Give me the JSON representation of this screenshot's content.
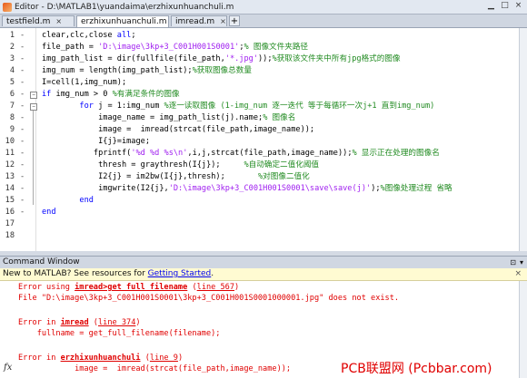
{
  "window": {
    "title": "Editor - D:\\MATLAB1\\yuandaima\\erzhixunhuanchuli.m"
  },
  "tabs": [
    {
      "label": "testfield.m",
      "close": "×",
      "active": false
    },
    {
      "label": "erzhixunhuanchuli.m",
      "close": "×",
      "active": true
    },
    {
      "label": "imread.m",
      "close": "×",
      "active": false
    }
  ],
  "tab_add": "+",
  "code_lines": [
    {
      "n": "1",
      "dash": "-",
      "segs": [
        {
          "t": "clear,clc,close ",
          "c": ""
        },
        {
          "t": "all",
          "c": "kw"
        },
        {
          "t": ";",
          "c": ""
        }
      ]
    },
    {
      "n": "2",
      "dash": "-",
      "segs": [
        {
          "t": "file_path = ",
          "c": ""
        },
        {
          "t": "'D:\\image\\3kp+3_C001H001S0001'",
          "c": "str"
        },
        {
          "t": ";",
          "c": ""
        },
        {
          "t": "% 图像文件夹路径",
          "c": "cm"
        }
      ]
    },
    {
      "n": "3",
      "dash": "-",
      "segs": [
        {
          "t": "img_path_list = dir(fullfile(file_path,",
          "c": ""
        },
        {
          "t": "'*.jpg'",
          "c": "str"
        },
        {
          "t": "));",
          "c": ""
        },
        {
          "t": "%获取该文件夹中所有jpg格式的图像",
          "c": "cm"
        }
      ]
    },
    {
      "n": "4",
      "dash": "-",
      "segs": [
        {
          "t": "img_num = length(img_path_list);",
          "c": ""
        },
        {
          "t": "%获取图像总数量",
          "c": "cm"
        }
      ]
    },
    {
      "n": "5",
      "dash": "-",
      "segs": [
        {
          "t": "I=cell(1,img_num);",
          "c": ""
        }
      ]
    },
    {
      "n": "6",
      "dash": "-",
      "segs": [
        {
          "t": "if",
          "c": "kw"
        },
        {
          "t": " img_num > 0 ",
          "c": ""
        },
        {
          "t": "%有满足条件的图像",
          "c": "cm"
        }
      ]
    },
    {
      "n": "7",
      "dash": "-",
      "segs": [
        {
          "t": "        ",
          "c": ""
        },
        {
          "t": "for",
          "c": "kw"
        },
        {
          "t": " j = 1:img_num ",
          "c": ""
        },
        {
          "t": "%逐一读取图像 (1-img_num 逐一迭代 等于每循环一次j+1 直到img_num)",
          "c": "cm"
        }
      ]
    },
    {
      "n": "8",
      "dash": "-",
      "segs": [
        {
          "t": "            image_name = img_path_list(j).name;",
          "c": ""
        },
        {
          "t": "% 图像名",
          "c": "cm"
        }
      ]
    },
    {
      "n": "9",
      "dash": "-",
      "segs": [
        {
          "t": "            image =  imread(strcat(file_path,image_name));",
          "c": ""
        }
      ]
    },
    {
      "n": "10",
      "dash": "-",
      "segs": [
        {
          "t": "            I{j}=image;",
          "c": ""
        }
      ]
    },
    {
      "n": "11",
      "dash": "-",
      "segs": [
        {
          "t": "           fprintf(",
          "c": ""
        },
        {
          "t": "'%d %d %s\\n'",
          "c": "str"
        },
        {
          "t": ",i,j,strcat(file_path,image_name));",
          "c": ""
        },
        {
          "t": "% 显示正在处理的图像名",
          "c": "cm"
        }
      ]
    },
    {
      "n": "12",
      "dash": "-",
      "segs": [
        {
          "t": "            thresh = graythresh(I{j});     ",
          "c": ""
        },
        {
          "t": "%自动确定二值化阈值",
          "c": "cm"
        }
      ]
    },
    {
      "n": "13",
      "dash": "-",
      "segs": [
        {
          "t": "            I2{j} = im2bw(I{j},thresh);       ",
          "c": ""
        },
        {
          "t": "%对图像二值化",
          "c": "cm"
        }
      ]
    },
    {
      "n": "14",
      "dash": "-",
      "segs": [
        {
          "t": "            imgwrite(I2{j},",
          "c": ""
        },
        {
          "t": "'D:\\image\\3kp+3_C001H001S0001\\save\\save(j)'",
          "c": "str"
        },
        {
          "t": ");",
          "c": ""
        },
        {
          "t": "%图像处理过程 省略",
          "c": "cm"
        }
      ]
    },
    {
      "n": "15",
      "dash": "-",
      "segs": [
        {
          "t": "        ",
          "c": ""
        },
        {
          "t": "end",
          "c": "kw"
        }
      ]
    },
    {
      "n": "16",
      "dash": "-",
      "segs": [
        {
          "t": "end",
          "c": "kw"
        }
      ]
    },
    {
      "n": "17",
      "dash": "",
      "segs": [
        {
          "t": "",
          "c": ""
        }
      ]
    },
    {
      "n": "18",
      "dash": "",
      "segs": [
        {
          "t": "",
          "c": ""
        }
      ]
    }
  ],
  "command_window": {
    "title": "Command Window",
    "banner_text": "New to MATLAB? See resources for ",
    "banner_link": "Getting Started",
    "banner_tail": ".",
    "close": "×",
    "errors": [
      {
        "pre": "Error using ",
        "fn": "imread>get_full_filename",
        "mid": " (",
        "ln": "line 567",
        "post": ")"
      },
      {
        "pre": "File \"D:\\image\\3kp+3_C001H001S0001\\3kp+3_C001H001S0001000001.jpg\" does not exist.",
        "fn": "",
        "mid": "",
        "ln": "",
        "post": ""
      },
      {
        "pre": "Error in ",
        "fn": "imread",
        "mid": " (",
        "ln": "line 374",
        "post": ")"
      },
      {
        "pre": "    fullname = get_full_filename(filename);",
        "fn": "",
        "mid": "",
        "ln": "",
        "post": ""
      },
      {
        "pre": "Error in ",
        "fn": "erzhixunhuanchuli",
        "mid": " (",
        "ln": "line 9",
        "post": ")"
      },
      {
        "pre": "            image =  imread(strcat(file_path,image_name));",
        "fn": "",
        "mid": "",
        "ln": "",
        "post": ""
      }
    ],
    "prompt": "fx"
  },
  "watermark": "PCB联盟网 (Pcbbar.com)",
  "colors": {
    "keyword": "#0000ff",
    "string": "#a020f0",
    "comment": "#228b22",
    "error": "#e00000"
  }
}
